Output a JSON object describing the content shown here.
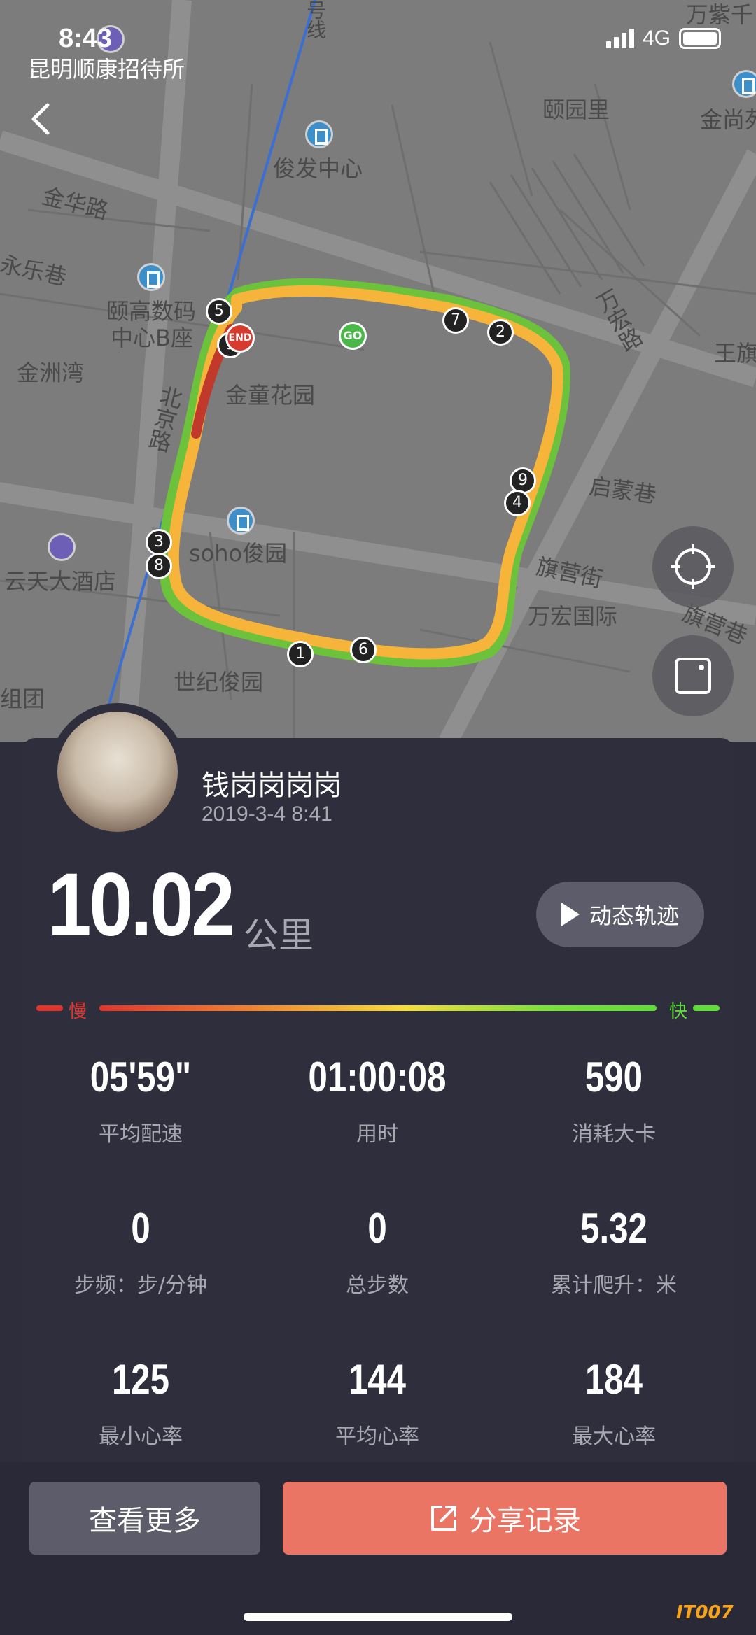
{
  "status_bar": {
    "time": "8:43",
    "network": "4G"
  },
  "map": {
    "labels": [
      {
        "id": "hostel",
        "text": "昆明顺康招待所"
      },
      {
        "id": "yiyuanli",
        "text": "颐园里"
      },
      {
        "id": "jinshang",
        "text": "金尚苑"
      },
      {
        "id": "wanzi",
        "text": "万紫千"
      },
      {
        "id": "junfa",
        "text": "俊发中心"
      },
      {
        "id": "jinhua",
        "text": "金华路"
      },
      {
        "id": "yongle",
        "text": "永乐巷"
      },
      {
        "id": "yigao",
        "text": "颐高数码"
      },
      {
        "id": "yigao2",
        "text": "中心B座"
      },
      {
        "id": "jinzhou",
        "text": "金洲湾"
      },
      {
        "id": "jintong",
        "text": "金童花园"
      },
      {
        "id": "beijing",
        "text": "北京路"
      },
      {
        "id": "wanhong_rd",
        "text": "万宏路"
      },
      {
        "id": "wangqi",
        "text": "王旗"
      },
      {
        "id": "qimeng",
        "text": "启蒙巷"
      },
      {
        "id": "soho",
        "text": "soho俊园"
      },
      {
        "id": "yuntian",
        "text": "云天大酒店"
      },
      {
        "id": "qiying",
        "text": "旗营街"
      },
      {
        "id": "wanhong_intl",
        "text": "万宏国际"
      },
      {
        "id": "qiying2",
        "text": "旗营巷"
      },
      {
        "id": "shiji",
        "text": "世纪俊园"
      },
      {
        "id": "zutuan",
        "text": "组团"
      },
      {
        "id": "line",
        "text": "号线"
      }
    ],
    "km_markers": [
      "1",
      "2",
      "3",
      "4",
      "5",
      "6",
      "7",
      "8",
      "9"
    ],
    "start_label": "GO",
    "end_label": "END"
  },
  "user": {
    "name": "钱岗岗岗岗",
    "date": "2019-3-4 8:41"
  },
  "run": {
    "distance": "10.02",
    "distance_unit": "公里",
    "replay_label": "动态轨迹",
    "pace_slow": "慢",
    "pace_fast": "快"
  },
  "stats": [
    {
      "value": "05'59\"",
      "label": "平均配速"
    },
    {
      "value": "01:00:08",
      "label": "用时"
    },
    {
      "value": "590",
      "label": "消耗大卡"
    },
    {
      "value": "0",
      "label": "步频：步/分钟"
    },
    {
      "value": "0",
      "label": "总步数"
    },
    {
      "value": "5.32",
      "label": "累计爬升：米"
    },
    {
      "value": "125",
      "label": "最小心率"
    },
    {
      "value": "144",
      "label": "平均心率"
    },
    {
      "value": "184",
      "label": "最大心率"
    }
  ],
  "buttons": {
    "more": "查看更多",
    "share": "分享记录"
  },
  "watermark": "IT007",
  "colors": {
    "accent": "#ea7565",
    "card": "#2f2e3c",
    "route_fast": "#6cc23a",
    "route_mid": "#f6b53a",
    "route_slow": "#c0392b"
  }
}
